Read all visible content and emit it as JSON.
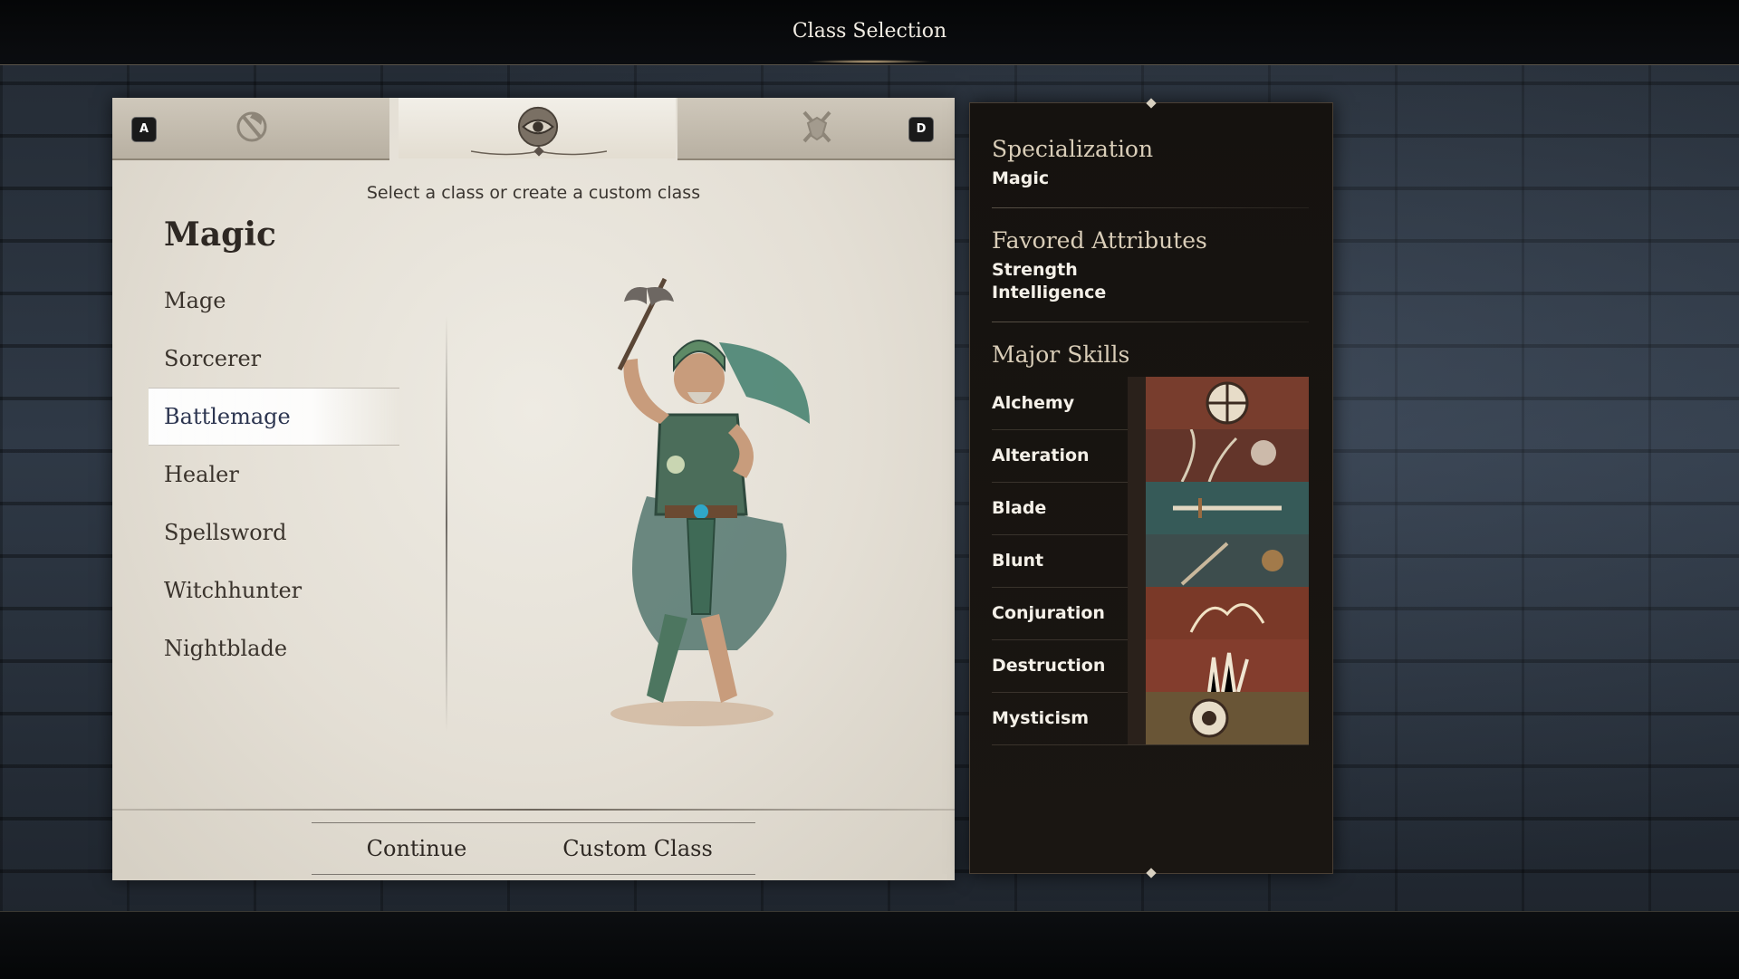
{
  "header": {
    "title": "Class Selection"
  },
  "tabs": [
    {
      "key": "A",
      "icon": "axe-emblem-icon",
      "active": false
    },
    {
      "key": "",
      "icon": "eye-emblem-icon",
      "active": true
    },
    {
      "key": "D",
      "icon": "crossed-swords-shield-icon",
      "active": false
    }
  ],
  "selection": {
    "prompt": "Select a class or create a custom class",
    "category": "Magic",
    "classes": [
      "Mage",
      "Sorcerer",
      "Battlemage",
      "Healer",
      "Spellsword",
      "Witchhunter",
      "Nightblade"
    ],
    "selected": "Battlemage"
  },
  "actions": {
    "continue_label": "Continue",
    "custom_label": "Custom Class"
  },
  "info": {
    "specialization_title": "Specialization",
    "specialization_value": "Magic",
    "attributes_title": "Favored Attributes",
    "attributes": [
      "Strength",
      "Intelligence"
    ],
    "skills_title": "Major Skills",
    "skills": [
      {
        "name": "Alchemy",
        "color": "#b8563c"
      },
      {
        "name": "Alteration",
        "color": "#9c4a3a"
      },
      {
        "name": "Blade",
        "color": "#3f8a8a"
      },
      {
        "name": "Blunt",
        "color": "#4f7a80"
      },
      {
        "name": "Conjuration",
        "color": "#b04a32"
      },
      {
        "name": "Destruction",
        "color": "#c0503a"
      },
      {
        "name": "Mysticism",
        "color": "#a88a52"
      }
    ]
  },
  "colors": {
    "parchment": "#e4dfd5",
    "panel": "#15120f",
    "selected_text": "#2c3550"
  }
}
